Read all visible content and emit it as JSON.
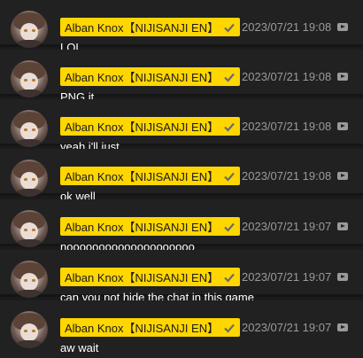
{
  "chat": {
    "messages": [
      {
        "author": "Alban Knox【NIJISANJI EN】",
        "timestamp": "2023/07/21 19:08",
        "text": "LOL"
      },
      {
        "author": "Alban Knox【NIJISANJI EN】",
        "timestamp": "2023/07/21 19:08",
        "text": "PNG it"
      },
      {
        "author": "Alban Knox【NIJISANJI EN】",
        "timestamp": "2023/07/21 19:08",
        "text": "yeah i'll just"
      },
      {
        "author": "Alban Knox【NIJISANJI EN】",
        "timestamp": "2023/07/21 19:08",
        "text": "ok well"
      },
      {
        "author": "Alban Knox【NIJISANJI EN】",
        "timestamp": "2023/07/21 19:07",
        "text": "noooooooooooooooooooo"
      },
      {
        "author": "Alban Knox【NIJISANJI EN】",
        "timestamp": "2023/07/21 19:07",
        "text": "can you not hide the chat in this game"
      },
      {
        "author": "Alban Knox【NIJISANJI EN】",
        "timestamp": "2023/07/21 19:07",
        "text": "aw wait"
      }
    ]
  },
  "icons": {
    "verified": "checkmark-icon",
    "source": "youtube-icon"
  },
  "colors": {
    "badge_bg": "#ffd600",
    "row_bg": "#212121",
    "timestamp": "#9a9a9a",
    "message_text": "#ffffff"
  }
}
